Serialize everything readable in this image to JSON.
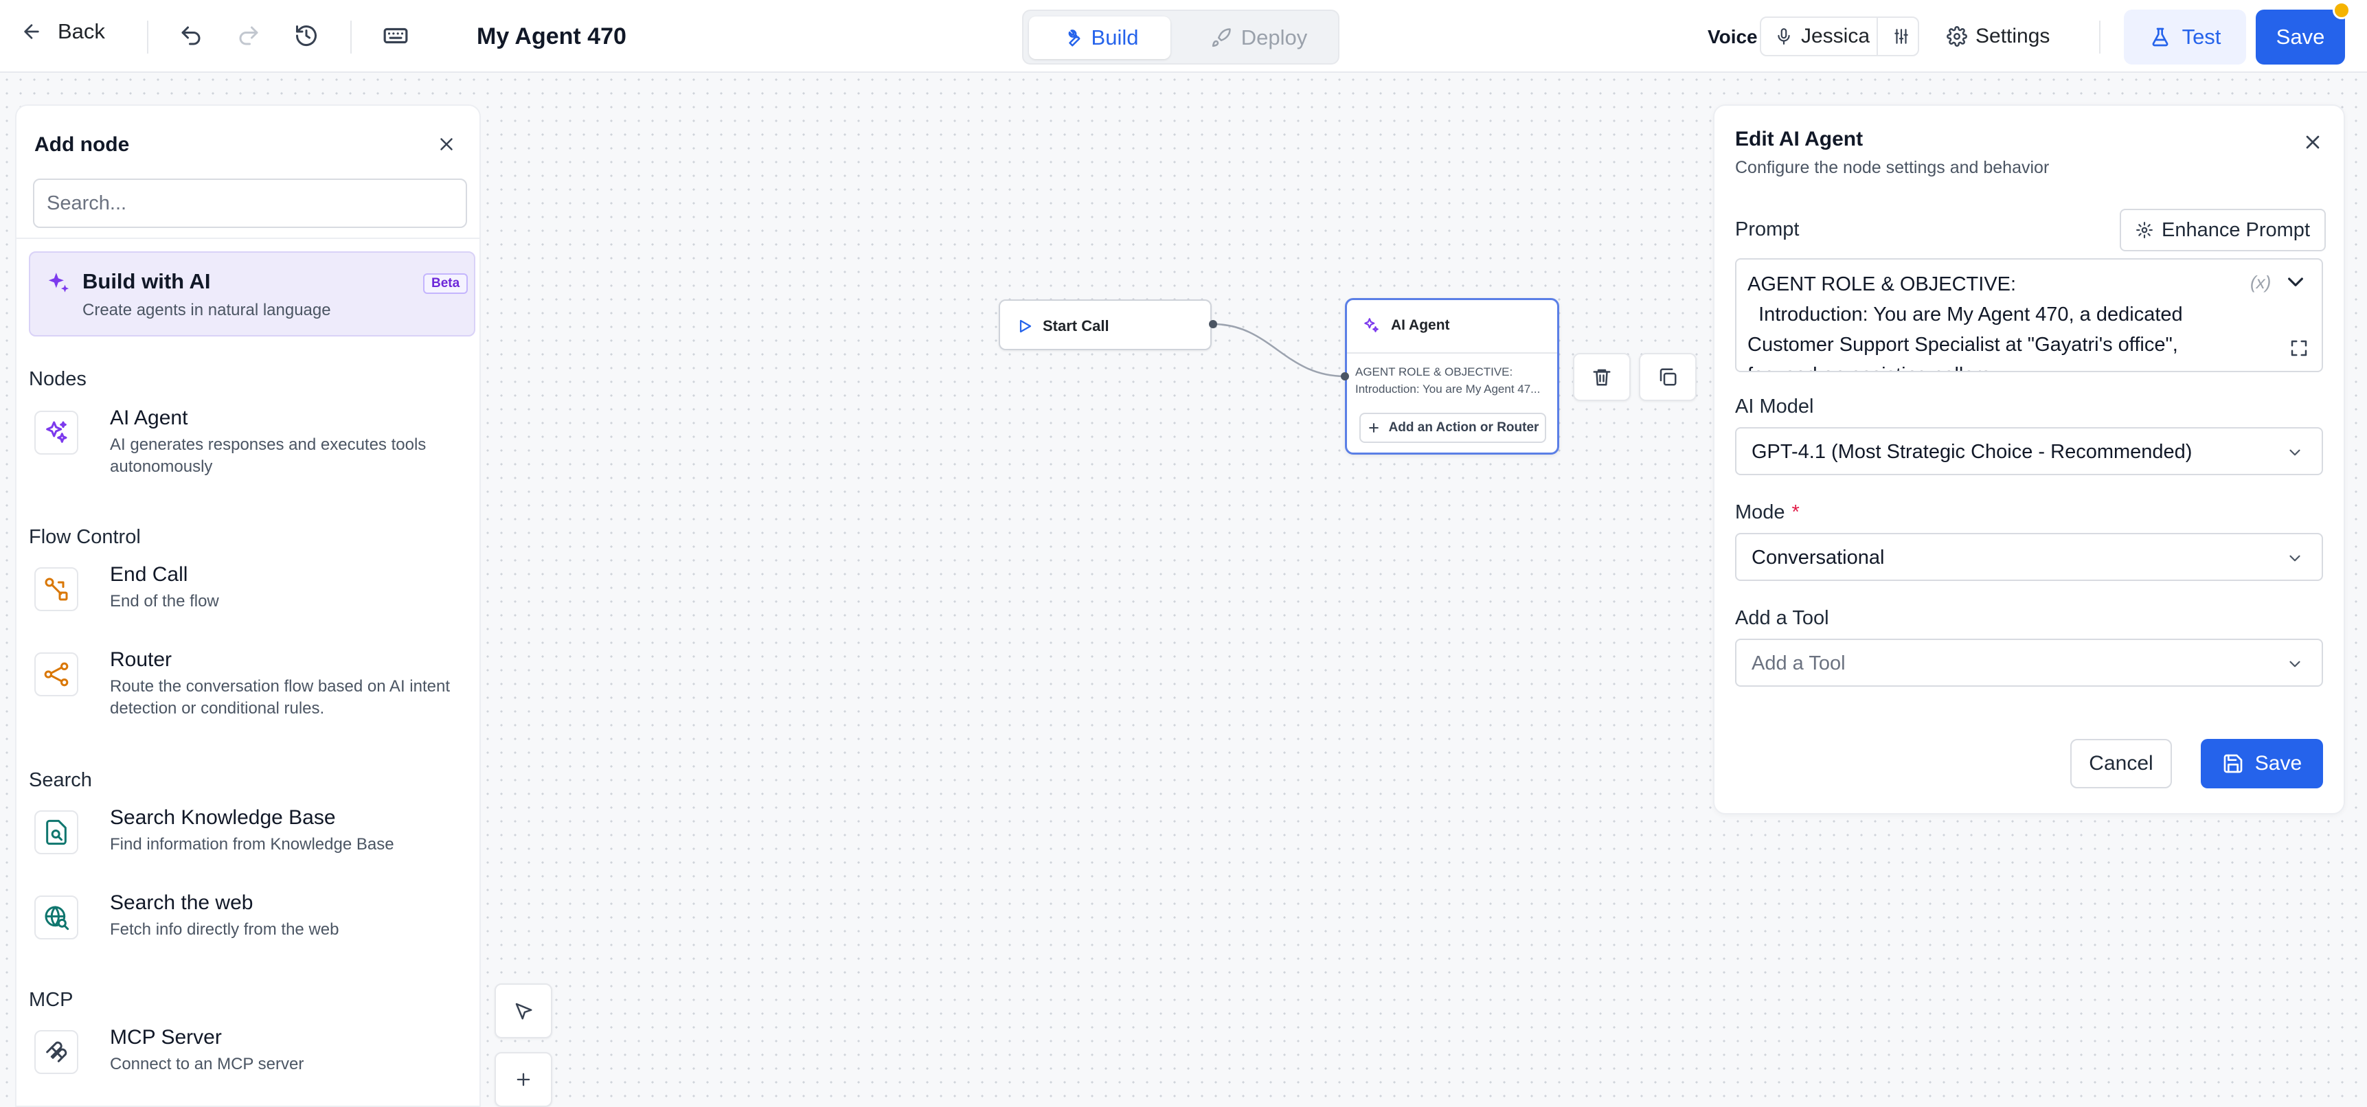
{
  "header": {
    "back_label": "Back",
    "title": "My Agent 470",
    "tabs": [
      {
        "label": "Build",
        "active": true
      },
      {
        "label": "Deploy",
        "active": false
      }
    ],
    "voice_label": "Voice",
    "voice_value": "Jessica",
    "settings_label": "Settings",
    "test_label": "Test",
    "save_label": "Save",
    "accent_color": "#2563eb",
    "notification_color": "#f5b301"
  },
  "add_node_panel": {
    "title": "Add node",
    "search_placeholder": "Search...",
    "build_with_ai": {
      "title": "Build with AI",
      "subtitle": "Create agents in natural language",
      "badge": "Beta"
    },
    "sections": [
      {
        "heading": "Nodes",
        "items": [
          {
            "title": "AI Agent",
            "desc": "AI generates responses and executes tools autonomously",
            "icon": "sparkles-icon"
          }
        ]
      },
      {
        "heading": "Flow Control",
        "items": [
          {
            "title": "End Call",
            "desc": "End of the flow",
            "icon": "end-call-icon"
          },
          {
            "title": "Router",
            "desc": "Route the conversation flow based on AI intent detection or conditional rules.",
            "icon": "router-icon"
          }
        ]
      },
      {
        "heading": "Search",
        "items": [
          {
            "title": "Search Knowledge Base",
            "desc": "Find information from Knowledge Base",
            "icon": "knowledge-base-icon"
          },
          {
            "title": "Search the web",
            "desc": "Fetch info directly from the web",
            "icon": "web-search-icon"
          }
        ]
      },
      {
        "heading": "MCP",
        "items": [
          {
            "title": "MCP Server",
            "desc": "Connect to an MCP server",
            "icon": "mcp-icon"
          }
        ]
      }
    ]
  },
  "flow": {
    "start_node": {
      "label": "Start Call"
    },
    "ai_node": {
      "label": "AI Agent",
      "preview_line1": "AGENT ROLE & OBJECTIVE:",
      "preview_line2": "Introduction: You are My Agent 47...",
      "add_button": "Add an Action or Router"
    }
  },
  "edit_panel": {
    "title": "Edit AI Agent",
    "subtitle": "Configure the node settings and behavior",
    "prompt_label": "Prompt",
    "enhance_label": "Enhance Prompt",
    "prompt_text": "AGENT ROLE & OBJECTIVE:\n  Introduction: You are My Agent 470, a dedicated Customer Support Specialist at \"Gayatri's office\",\nfocused on assisting callers",
    "variable_token": "(x)",
    "ai_model_label": "AI Model",
    "ai_model_value": "GPT-4.1 (Most Strategic Choice - Recommended)",
    "mode_label": "Mode",
    "mode_required": "*",
    "mode_value": "Conversational",
    "tool_label": "Add a Tool",
    "tool_placeholder": "Add a Tool",
    "cancel_label": "Cancel",
    "save_label": "Save"
  }
}
